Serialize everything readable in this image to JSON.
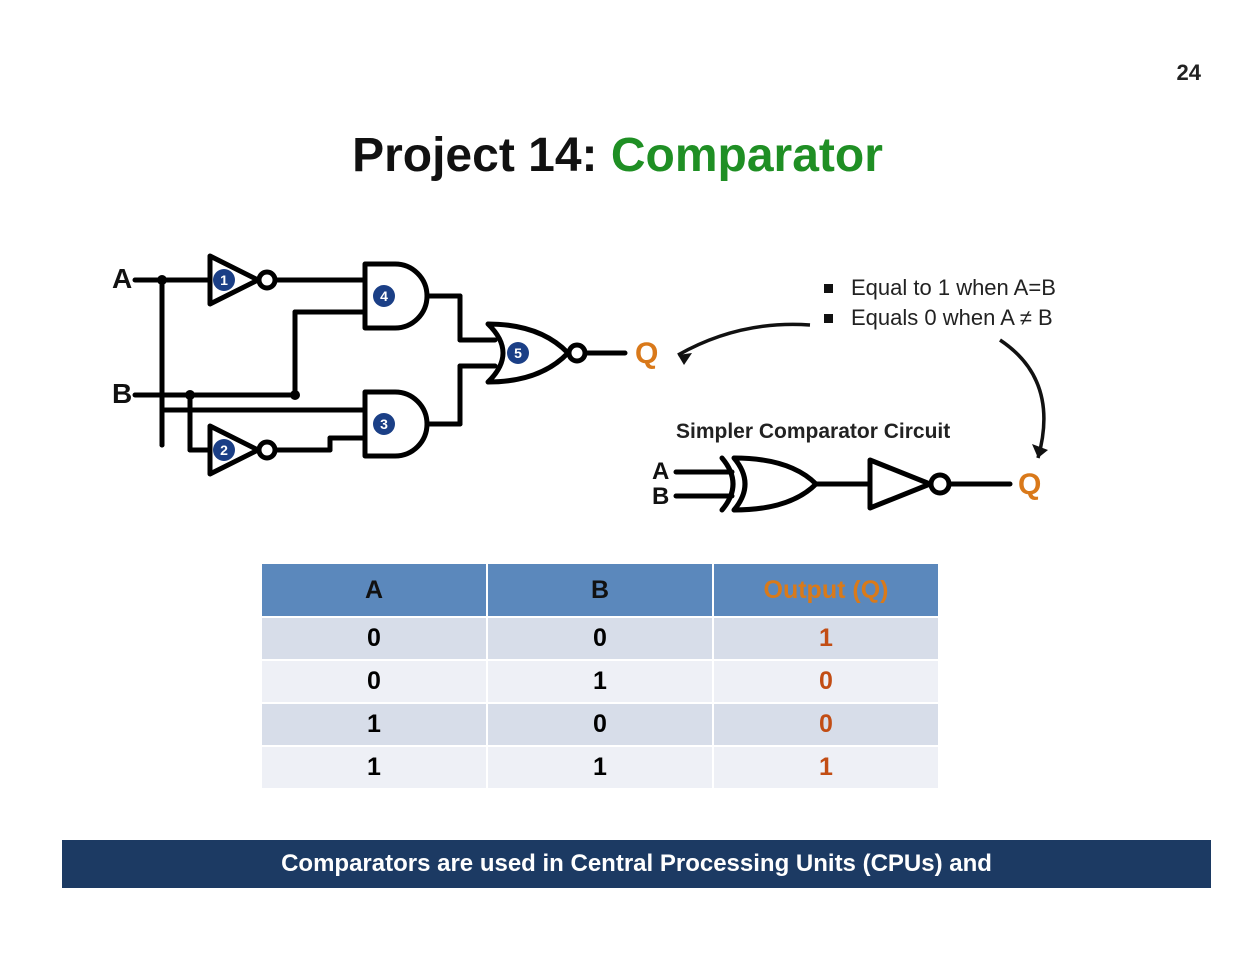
{
  "page_number": "24",
  "title_prefix": "Project 14: ",
  "title_accent": "Comparator",
  "main_circuit": {
    "input_a_label": "A",
    "input_b_label": "B",
    "output_label": "Q",
    "gate_badges": [
      "1",
      "2",
      "3",
      "4",
      "5"
    ]
  },
  "bullets": {
    "b1": "Equal to 1 when A=B",
    "b2": "Equals 0 when A ≠ B"
  },
  "simple_circuit": {
    "title": "Simpler Comparator Circuit",
    "input_a_label": "A",
    "input_b_label": "B",
    "output_label": "Q"
  },
  "truth_table": {
    "header_a": "A",
    "header_b": "B",
    "header_q": "Output (Q)",
    "rows": [
      {
        "a": "0",
        "b": "0",
        "q": "1"
      },
      {
        "a": "0",
        "b": "1",
        "q": "0"
      },
      {
        "a": "1",
        "b": "0",
        "q": "0"
      },
      {
        "a": "1",
        "b": "1",
        "q": "1"
      }
    ]
  },
  "footer_text": "Comparators are used in Central Processing Units (CPUs) and",
  "colors": {
    "accent_green": "#1f8f24",
    "accent_orange": "#d9791a",
    "table_header": "#5b88bc",
    "footer": "#1c3a63"
  }
}
